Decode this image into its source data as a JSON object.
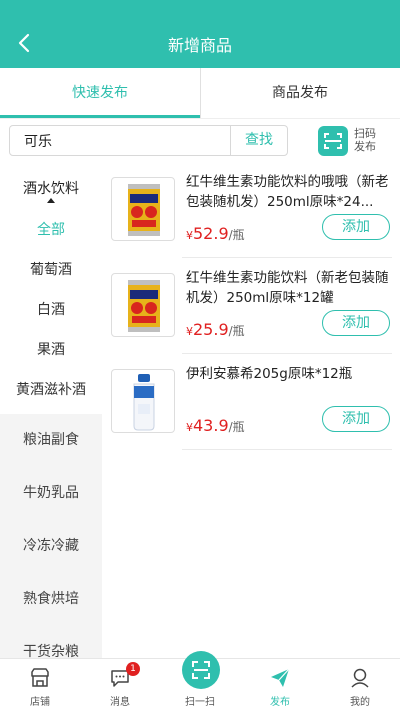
{
  "header": {
    "title": "新增商品"
  },
  "tabs": [
    {
      "label": "快速发布",
      "active": true
    },
    {
      "label": "商品发布",
      "active": false
    }
  ],
  "search": {
    "value": "可乐",
    "button": "查找",
    "scan_line1": "扫码",
    "scan_line2": "发布"
  },
  "sidebar": {
    "group": "酒水饮料",
    "subs": [
      "全部",
      "葡萄酒",
      "白酒",
      "果酒",
      "黄酒滋补酒"
    ],
    "active_sub": "全部",
    "categories": [
      "粮油副食",
      "牛奶乳品",
      "冷冻冷藏",
      "熟食烘培",
      "干货杂粮"
    ]
  },
  "products": [
    {
      "name": "红牛维生素功能饮料的哦哦（新老包装随机发）250ml原味*24...",
      "currency": "¥",
      "price": "52.9",
      "unit": "/瓶",
      "add": "添加",
      "image": "red-bull-can-icon"
    },
    {
      "name": "红牛维生素功能饮料（新老包装随机发）250ml原味*12罐",
      "currency": "¥",
      "price": "25.9",
      "unit": "/瓶",
      "add": "添加",
      "image": "red-bull-can-icon"
    },
    {
      "name": "伊利安慕希205g原味*12瓶",
      "currency": "¥",
      "price": "43.9",
      "unit": "/瓶",
      "add": "添加",
      "image": "yogurt-bottle-icon"
    }
  ],
  "bottom_nav": {
    "items": [
      {
        "label": "店铺",
        "icon": "store-icon",
        "active": false
      },
      {
        "label": "消息",
        "icon": "message-icon",
        "active": false,
        "badge": "1"
      },
      {
        "label": "扫一扫",
        "icon": "scan-icon",
        "active": false
      },
      {
        "label": "发布",
        "icon": "send-icon",
        "active": true
      },
      {
        "label": "我的",
        "icon": "user-icon",
        "active": false
      }
    ]
  },
  "colors": {
    "accent": "#2fbfae",
    "price": "#e02020",
    "badge": "#e02020"
  }
}
